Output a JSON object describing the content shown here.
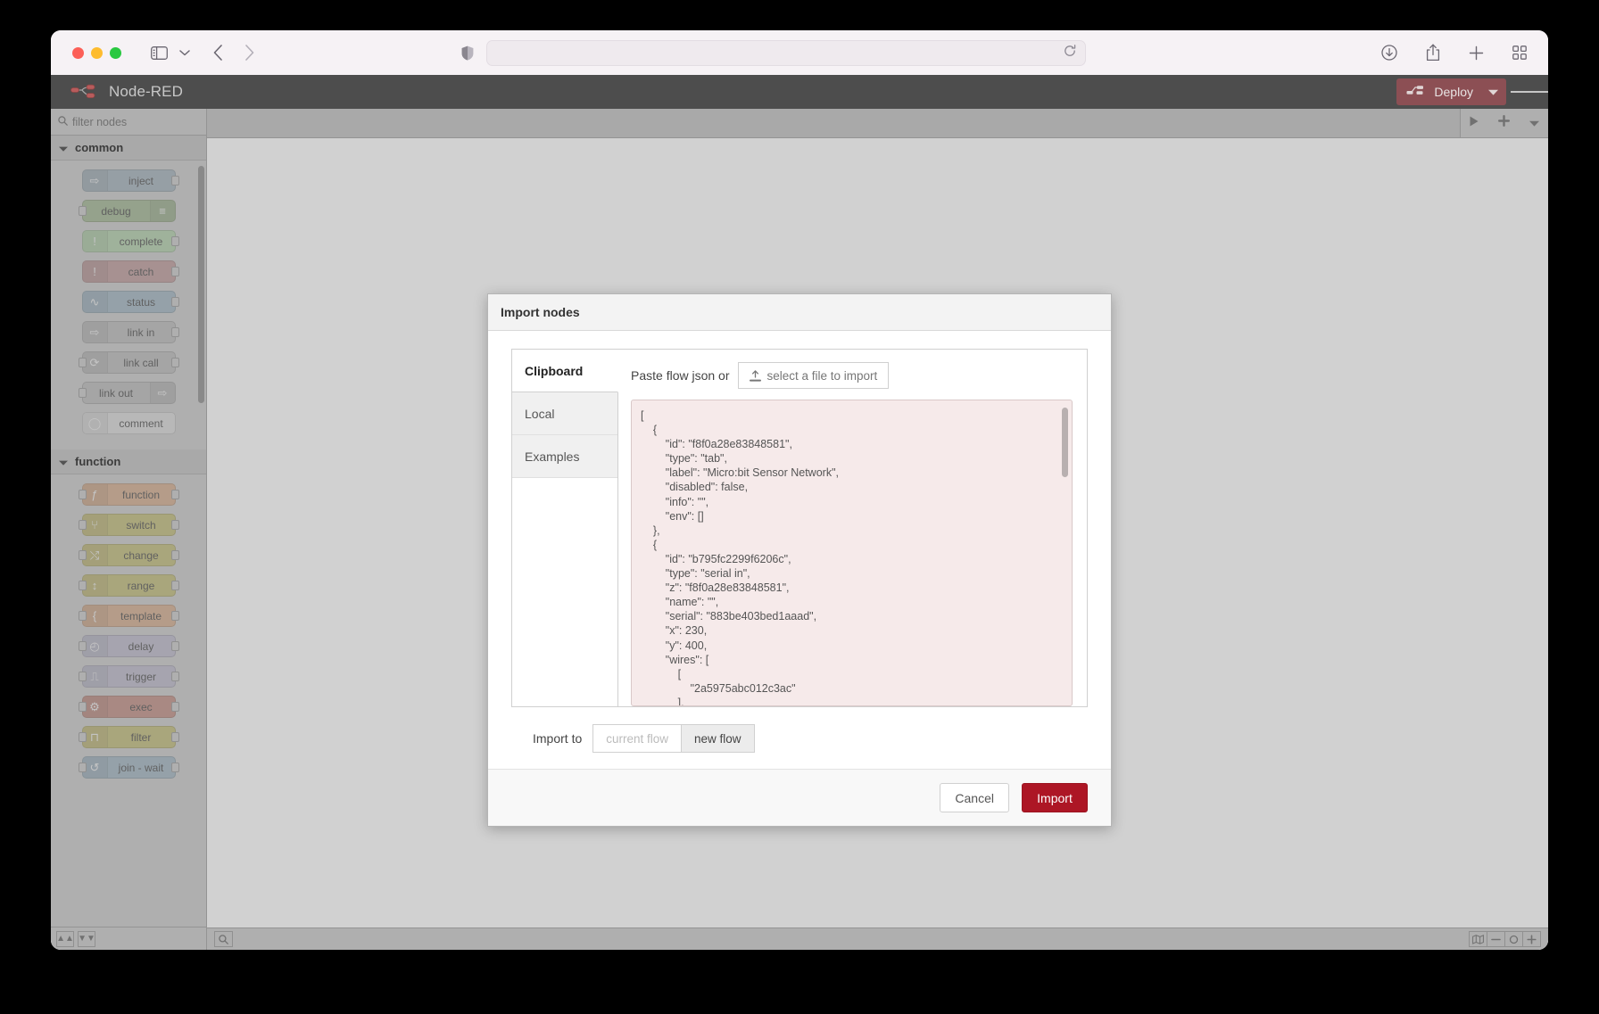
{
  "browser": {
    "url": "",
    "url_placeholder": "",
    "icons": {
      "sidebar": "sidebar-icon",
      "chevron_down": "chevron-down-icon",
      "back": "back-arrow-icon",
      "forward": "forward-arrow-icon",
      "shield": "shield-icon",
      "reload": "reload-icon",
      "download": "download-icon",
      "share": "share-icon",
      "new_tab": "plus-icon",
      "tab_overview": "tab-overview-icon"
    }
  },
  "app": {
    "title": "Node-RED",
    "deploy_label": "Deploy",
    "accent": "#8c4f54",
    "header_bg": "#4d4d4d"
  },
  "palette": {
    "search_placeholder": "filter nodes",
    "categories": [
      {
        "name": "common",
        "nodes": [
          {
            "label": "inject",
            "color": "#a7b8c4",
            "icon": "⇨",
            "has_input": false,
            "has_output": true,
            "icon_side": "left"
          },
          {
            "label": "debug",
            "color": "#a4bd92",
            "icon": "≡",
            "has_input": true,
            "has_output": false,
            "icon_side": "right"
          },
          {
            "label": "complete",
            "color": "#b8ddb0",
            "icon": "!",
            "has_input": false,
            "has_output": true,
            "icon_side": "left"
          },
          {
            "label": "catch",
            "color": "#c69b9b",
            "icon": "!",
            "has_input": false,
            "has_output": true,
            "icon_side": "left"
          },
          {
            "label": "status",
            "color": "#a3bccb",
            "icon": "∿",
            "has_input": false,
            "has_output": true,
            "icon_side": "left"
          },
          {
            "label": "link in",
            "color": "#c4c4c4",
            "icon": "⇨",
            "has_input": false,
            "has_output": true,
            "icon_side": "left"
          },
          {
            "label": "link call",
            "color": "#c4c4c4",
            "icon": "⟳",
            "has_input": true,
            "has_output": true,
            "icon_side": "left"
          },
          {
            "label": "link out",
            "color": "#c4c4c4",
            "icon": "⇨",
            "has_input": true,
            "has_output": false,
            "icon_side": "right"
          },
          {
            "label": "comment",
            "color": "#e8e8e8",
            "icon": "◯",
            "has_input": false,
            "has_output": false,
            "icon_side": "left"
          }
        ]
      },
      {
        "name": "function",
        "nodes": [
          {
            "label": "function",
            "color": "#e2b28c",
            "icon": "ƒ",
            "has_input": true,
            "has_output": true,
            "icon_side": "left"
          },
          {
            "label": "switch",
            "color": "#ccc573",
            "icon": "⑂",
            "has_input": true,
            "has_output": true,
            "icon_side": "left"
          },
          {
            "label": "change",
            "color": "#ccc573",
            "icon": "⤭",
            "has_input": true,
            "has_output": true,
            "icon_side": "left"
          },
          {
            "label": "range",
            "color": "#ccc573",
            "icon": "↕",
            "has_input": true,
            "has_output": true,
            "icon_side": "left"
          },
          {
            "label": "template",
            "color": "#e2b28c",
            "icon": "{",
            "has_input": true,
            "has_output": true,
            "icon_side": "left"
          },
          {
            "label": "delay",
            "color": "#c5c2d6",
            "icon": "◴",
            "has_input": true,
            "has_output": true,
            "icon_side": "left"
          },
          {
            "label": "trigger",
            "color": "#c5c2d6",
            "icon": "⎍",
            "has_input": true,
            "has_output": true,
            "icon_side": "left"
          },
          {
            "label": "exec",
            "color": "#cb8d80",
            "icon": "⚙",
            "has_input": true,
            "has_output": true,
            "icon_side": "left"
          },
          {
            "label": "filter",
            "color": "#ccc573",
            "icon": "⊓",
            "has_input": true,
            "has_output": true,
            "icon_side": "left"
          },
          {
            "label": "join - wait",
            "color": "#a3bccb",
            "icon": "↺",
            "has_input": true,
            "has_output": true,
            "icon_side": "left"
          }
        ]
      }
    ]
  },
  "workspace": {
    "tab_actions": [
      "play-icon",
      "add-flow-icon",
      "flow-menu-icon"
    ],
    "status_left": [
      "collapse-all-icon",
      "expand-all-icon",
      "search-icon"
    ],
    "status_right": [
      "navigator-icon",
      "zoom-out-icon",
      "zoom-reset-icon",
      "zoom-in-icon"
    ]
  },
  "dialog": {
    "title": "Import nodes",
    "tabs": [
      {
        "label": "Clipboard",
        "active": true
      },
      {
        "label": "Local",
        "active": false
      },
      {
        "label": "Examples",
        "active": false
      }
    ],
    "paste_label": "Paste flow json or",
    "file_button_label": "select a file to import",
    "json_content": "[\n    {\n        \"id\": \"f8f0a28e83848581\",\n        \"type\": \"tab\",\n        \"label\": \"Micro:bit Sensor Network\",\n        \"disabled\": false,\n        \"info\": \"\",\n        \"env\": []\n    },\n    {\n        \"id\": \"b795fc2299f6206c\",\n        \"type\": \"serial in\",\n        \"z\": \"f8f0a28e83848581\",\n        \"name\": \"\",\n        \"serial\": \"883be403bed1aaad\",\n        \"x\": 230,\n        \"y\": 400,\n        \"wires\": [\n            [\n                \"2a5975abc012c3ac\"\n            ],",
    "import_to_label": "Import to",
    "segments": [
      {
        "label": "current flow",
        "selected": false
      },
      {
        "label": "new flow",
        "selected": true
      }
    ],
    "cancel_label": "Cancel",
    "import_label": "Import",
    "import_color": "#ad1625"
  }
}
